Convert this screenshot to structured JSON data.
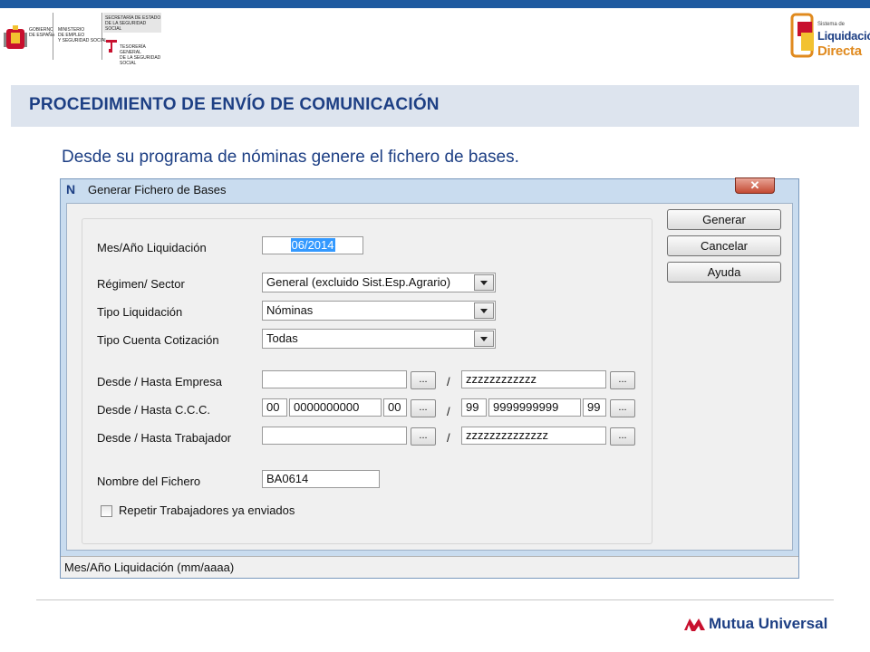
{
  "branding": {
    "gobierno": "GOBIERNO\nDE ESPAÑA",
    "ministerio": "MINISTERIO\nDE EMPLEO\nY SEGURIDAD SOCIAL",
    "secretaria": "SECRETARÍA DE ESTADO\nDE LA SEGURIDAD SOCIAL",
    "tesoreria": "TESORERÍA GENERAL\nDE LA SEGURIDAD SOCIAL",
    "sistema_small": "Sistema de",
    "liquidacion": "Liquidación",
    "directa": "Directa",
    "mutua": "Mutua Universal"
  },
  "slide": {
    "title": "PROCEDIMIENTO DE ENVÍO DE COMUNICACIÓN",
    "intro": "Desde su programa de nóminas genere el fichero de bases."
  },
  "window": {
    "icon": "N",
    "title": "Generar Fichero de Bases",
    "close": "✕",
    "status": "Mes/Año Liquidación  (mm/aaaa)"
  },
  "form": {
    "mes_label": "Mes/Año Liquidación",
    "mes_value": "06/2014",
    "regimen_label": "Régimen/ Sector",
    "regimen_value": "General (excluido Sist.Esp.Agrario)",
    "tipo_liq_label": "Tipo Liquidación",
    "tipo_liq_value": "Nóminas",
    "tipo_cuenta_label": "Tipo Cuenta Cotización",
    "tipo_cuenta_value": "Todas",
    "empresa_label": "Desde / Hasta Empresa",
    "empresa_from": "",
    "empresa_to": "zzzzzzzzzzzz",
    "ccc_label": "Desde / Hasta  C.C.C.",
    "ccc_from_1": "00",
    "ccc_from_2": "0000000000",
    "ccc_from_3": "00",
    "ccc_to_1": "99",
    "ccc_to_2": "9999999999",
    "ccc_to_3": "99",
    "trabajador_label": "Desde / Hasta Trabajador",
    "trabajador_from": "",
    "trabajador_to": "zzzzzzzzzzzzzz",
    "fichero_label": "Nombre del Fichero",
    "fichero_value": "BA0614",
    "repetir_label": "Repetir Trabajadores ya enviados",
    "dots": "...",
    "slash": "/"
  },
  "buttons": {
    "generar": "Generar",
    "cancelar": "Cancelar",
    "ayuda": "Ayuda"
  },
  "colors": {
    "brand_blue": "#1d3f84",
    "top_bar": "#1e5aa0",
    "header_band": "#dde4ee",
    "window_frame": "#c9dcef"
  }
}
